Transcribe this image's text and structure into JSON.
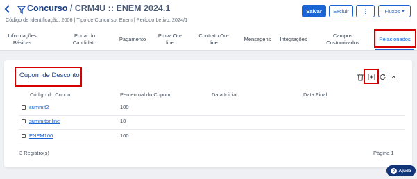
{
  "header": {
    "title_main": "Concurso",
    "title_path": " / CRM4U :: ENEM 2024.1",
    "subtitle": "Código de Identificação: 2006 | Tipo de Concurso: Enem | Período Letivo: 2024/1",
    "buttons": {
      "save": "Salvar",
      "delete": "Excluir",
      "more": "⋮",
      "flows": "Fluxos"
    }
  },
  "tabs": [
    {
      "label": "Informações\nBásicas",
      "active": false
    },
    {
      "label": "Portal do\nCandidato",
      "active": false
    },
    {
      "label": "Pagamento",
      "active": false
    },
    {
      "label": "Prova On-\nline",
      "active": false
    },
    {
      "label": "Contrato On-\nline",
      "active": false
    },
    {
      "label": "Mensagens",
      "active": false
    },
    {
      "label": "Integrações",
      "active": false
    },
    {
      "label": "Campos\nCustomizados",
      "active": false
    },
    {
      "label": "Relacionados",
      "active": true
    }
  ],
  "section": {
    "title": "Cupom de Desconto",
    "columns": [
      "Código do Cupom",
      "Percentual do Cupom",
      "Data Inicial",
      "Data Final"
    ],
    "rows": [
      {
        "code": "summit2",
        "percent": "100"
      },
      {
        "code": "summitonline",
        "percent": "10"
      },
      {
        "code": "ENEM100",
        "percent": "100"
      }
    ],
    "record_count": "3 Registro(s)",
    "page": "Página 1"
  },
  "help": {
    "label": "Ajuda"
  },
  "colors": {
    "primary": "#1a64d6",
    "title": "#163e86",
    "highlight": "#d40000"
  }
}
